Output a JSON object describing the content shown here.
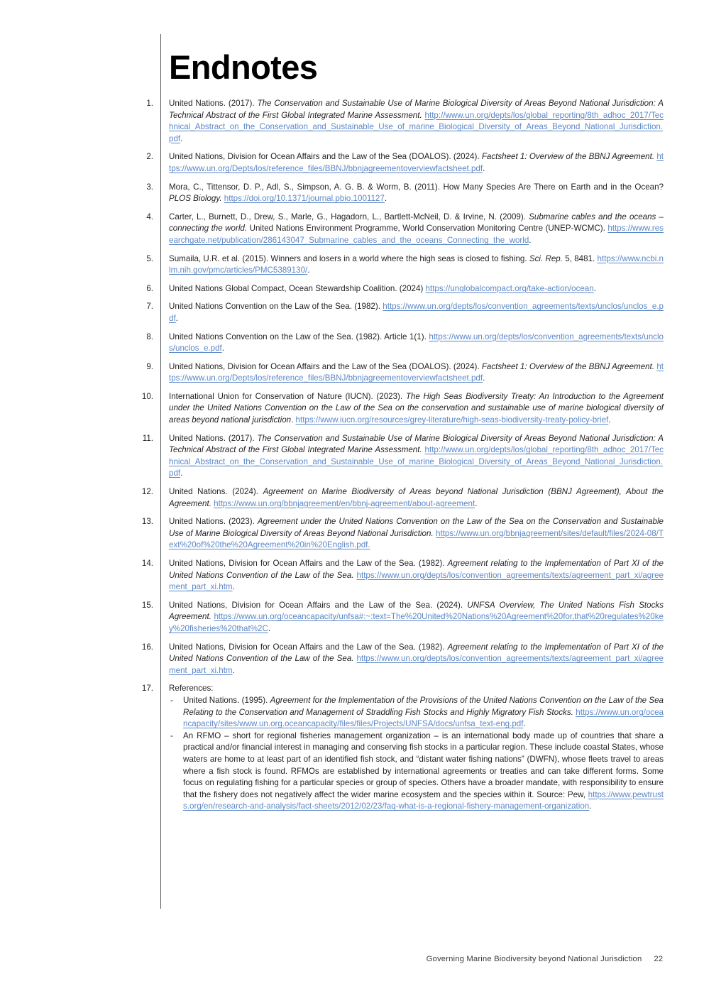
{
  "document": {
    "title": "Endnotes",
    "link_color": "#5b87c7",
    "text_color": "#231f20"
  },
  "footer": {
    "text": "Governing Marine Biodiversity beyond National Jurisdiction",
    "page_number": "22"
  },
  "endnotes": [
    {
      "number": "1.",
      "parts": [
        {
          "type": "text",
          "value": "United Nations. (2017). "
        },
        {
          "type": "italic",
          "value": "The Conservation and Sustainable Use of Marine Biological Diversity of Areas Beyond National Jurisdiction: A Technical Abstract of the First Global Integrated Marine Assessment."
        },
        {
          "type": "text",
          "value": " "
        },
        {
          "type": "link",
          "value": "http://www.un.org/depts/los/global_reporting/8th_adhoc_2017/Technical_Abstract_on_the_Conservation_and_Sustainable_Use_of_marine_Biological_Diversity_of_Areas_Beyond_National_Jurisdiction.pdf"
        },
        {
          "type": "text",
          "value": "."
        }
      ]
    },
    {
      "number": "2.",
      "parts": [
        {
          "type": "text",
          "value": "United Nations, Division for Ocean Affairs and the Law of the Sea (DOALOS). (2024). "
        },
        {
          "type": "italic",
          "value": "Factsheet 1: Overview of the BBNJ Agreement."
        },
        {
          "type": "text",
          "value": " "
        },
        {
          "type": "link",
          "value": "https://www.un.org/Depts/los/reference_files/BBNJ/bbnjagreementoverviewfactsheet.pdf"
        },
        {
          "type": "text",
          "value": "."
        }
      ]
    },
    {
      "number": "3.",
      "parts": [
        {
          "type": "text",
          "value": "Mora, C., Tittensor, D. P., Adl, S., Simpson, A. G. B. & Worm, B. (2011). How Many Species Are There on Earth and in the Ocean? "
        },
        {
          "type": "italic",
          "value": "PLOS Biology."
        },
        {
          "type": "text",
          "value": " "
        },
        {
          "type": "link",
          "value": "https://doi.org/10.1371/journal.pbio.1001127"
        },
        {
          "type": "text",
          "value": "."
        }
      ]
    },
    {
      "number": "4.",
      "parts": [
        {
          "type": "text",
          "value": "Carter, L., Burnett, D., Drew, S., Marle, G., Hagadorn, L., Bartlett-McNeil, D. & Irvine, N. (2009). "
        },
        {
          "type": "italic",
          "value": "Submarine cables and the oceans – connecting the world."
        },
        {
          "type": "text",
          "value": " United Nations Environment Programme, World Conservation Monitoring Centre (UNEP-WCMC). "
        },
        {
          "type": "link",
          "value": "https://www.researchgate.net/publication/286143047_Submarine_cables_and_the_oceans_Connecting_the_world"
        },
        {
          "type": "text",
          "value": "."
        }
      ]
    },
    {
      "number": "5.",
      "parts": [
        {
          "type": "text",
          "value": "Sumaila, U.R. et al. (2015). Winners and losers in a world where the high seas is closed to fishing. "
        },
        {
          "type": "italic",
          "value": "Sci. Rep."
        },
        {
          "type": "text",
          "value": " 5, 8481. "
        },
        {
          "type": "link",
          "value": "https://www.ncbi.nlm.nih.gov/pmc/articles/PMC5389130/"
        },
        {
          "type": "text",
          "value": "."
        }
      ]
    },
    {
      "number": "6.",
      "parts": [
        {
          "type": "text",
          "value": "United Nations Global Compact, Ocean Stewardship Coalition. (2024) "
        },
        {
          "type": "link",
          "value": "https://unglobalcompact.org/take-action/ocean"
        },
        {
          "type": "text",
          "value": "."
        }
      ]
    },
    {
      "number": "7.",
      "parts": [
        {
          "type": "text",
          "value": "United Nations Convention on the Law of the Sea. (1982). "
        },
        {
          "type": "link",
          "value": "https://www.un.org/depts/los/convention_agreements/texts/unclos/unclos_e.pdf"
        },
        {
          "type": "text",
          "value": "."
        }
      ]
    },
    {
      "number": "8.",
      "parts": [
        {
          "type": "text",
          "value": "United Nations Convention on the Law of the Sea. (1982). Article 1(1). "
        },
        {
          "type": "link",
          "value": "https://www.un.org/depts/los/convention_agreements/texts/unclos/unclos_e.pdf"
        },
        {
          "type": "text",
          "value": "."
        }
      ]
    },
    {
      "number": "9.",
      "parts": [
        {
          "type": "text",
          "value": "United Nations, Division for Ocean Affairs and the Law of the Sea (DOALOS). (2024). "
        },
        {
          "type": "italic",
          "value": "Factsheet 1: Overview of the BBNJ Agreement."
        },
        {
          "type": "text",
          "value": " "
        },
        {
          "type": "link",
          "value": "https://www.un.org/Depts/los/reference_files/BBNJ/bbnjagreementoverviewfactsheet.pdf"
        },
        {
          "type": "text",
          "value": "."
        }
      ]
    },
    {
      "number": "10.",
      "parts": [
        {
          "type": "text",
          "value": "International Union for Conservation of Nature (IUCN). (2023). "
        },
        {
          "type": "italic",
          "value": "The High Seas Biodiversity Treaty: An Introduction to the Agreement under the United Nations Convention on the Law of the Sea on the conservation and sustainable use of marine biological diversity of areas beyond national jurisdiction"
        },
        {
          "type": "text",
          "value": ". "
        },
        {
          "type": "link",
          "value": "https://www.iucn.org/resources/grey-literature/high-seas-biodiversity-treaty-policy-brief"
        },
        {
          "type": "text",
          "value": "."
        }
      ]
    },
    {
      "number": "11.",
      "parts": [
        {
          "type": "text",
          "value": "United Nations. (2017). "
        },
        {
          "type": "italic",
          "value": "The Conservation and Sustainable Use of Marine Biological Diversity of Areas Beyond National Jurisdiction: A Technical Abstract of the First Global Integrated Marine Assessment."
        },
        {
          "type": "text",
          "value": " "
        },
        {
          "type": "link",
          "value": "http://www.un.org/depts/los/global_reporting/8th_adhoc_2017/Technical_Abstract_on_the_Conservation_and_Sustainable_Use_of_marine_Biological_Diversity_of_Areas_Beyond_National_Jurisdiction.pdf"
        },
        {
          "type": "text",
          "value": "."
        }
      ]
    },
    {
      "number": "12.",
      "parts": [
        {
          "type": "text",
          "value": "United Nations. (2024). "
        },
        {
          "type": "italic",
          "value": "Agreement on Marine Biodiversity of Areas beyond National Jurisdiction (BBNJ Agreement), About the Agreement."
        },
        {
          "type": "text",
          "value": " "
        },
        {
          "type": "link",
          "value": "https://www.un.org/bbnjagreement/en/bbnj-agreement/about-agreement"
        },
        {
          "type": "text",
          "value": "."
        }
      ]
    },
    {
      "number": "13.",
      "parts": [
        {
          "type": "text",
          "value": "United Nations. (2023). "
        },
        {
          "type": "italic",
          "value": "Agreement under the United Nations Convention on the Law of the Sea on the Conservation and Sustainable Use of Marine Biological Diversity of Areas Beyond National Jurisdiction."
        },
        {
          "type": "text",
          "value": " "
        },
        {
          "type": "link",
          "value": "https://www.un.org/bbnjagreement/sites/default/files/2024-08/Text%20of%20the%20Agreement%20in%20English.pdf."
        }
      ]
    },
    {
      "number": "14.",
      "parts": [
        {
          "type": "text",
          "value": "United Nations, Division for Ocean Affairs and the Law of the Sea. (1982). "
        },
        {
          "type": "italic",
          "value": "Agreement relating to the Implementation of Part XI of the United Nations Convention of the Law of the Sea."
        },
        {
          "type": "text",
          "value": " "
        },
        {
          "type": "link",
          "value": "https://www.un.org/depts/los/convention_agreements/texts/agreement_part_xi/agreement_part_xi.htm"
        },
        {
          "type": "text",
          "value": "."
        }
      ]
    },
    {
      "number": "15.",
      "parts": [
        {
          "type": "text",
          "value": "United Nations, Division for Ocean Affairs and the Law of the Sea. (2024). "
        },
        {
          "type": "italic",
          "value": "UNFSA Overview, The United Nations Fish Stocks Agreement."
        },
        {
          "type": "text",
          "value": " "
        },
        {
          "type": "link",
          "value": "https://www.un.org/oceancapacity/unfsa#:~:text=The%20United%20Nations%20Agreement%20for,that%20regulates%20key%20fisheries%20that%2C"
        },
        {
          "type": "text",
          "value": "."
        }
      ]
    },
    {
      "number": "16.",
      "parts": [
        {
          "type": "text",
          "value": "United Nations, Division for Ocean Affairs and the Law of the Sea. (1982). "
        },
        {
          "type": "italic",
          "value": "Agreement relating to the Implementation of Part XI of the United Nations Convention of the Law of the Sea."
        },
        {
          "type": "text",
          "value": " "
        },
        {
          "type": "link",
          "value": "https://www.un.org/depts/los/convention_agreements/texts/agreement_part_xi/agreement_part_xi.htm"
        },
        {
          "type": "text",
          "value": "."
        }
      ]
    },
    {
      "number": "17.",
      "parts": [
        {
          "type": "text",
          "value": "References:"
        }
      ],
      "sublist": [
        {
          "bullet": "-",
          "parts": [
            {
              "type": "text",
              "value": "United Nations. (1995). "
            },
            {
              "type": "italic",
              "value": "Agreement for the Implementation of the Provisions of the United Nations Convention on the Law of the Sea Relating to the Conservation and Management of Straddling Fish Stocks and Highly Migratory Fish Stocks."
            },
            {
              "type": "text",
              "value": " "
            },
            {
              "type": "link",
              "value": "https://www.un.org/oceancapacity/sites/www.un.org.oceancapacity/files/files/Projects/UNFSA/docs/unfsa_text-eng.pdf"
            },
            {
              "type": "text",
              "value": "."
            }
          ]
        },
        {
          "bullet": "-",
          "parts": [
            {
              "type": "text",
              "value": "An RFMO – short for regional fisheries management organization – is an international body made up of countries that share a practical and/or financial interest in managing and conserving fish stocks in a particular region. These include coastal States, whose waters are home to at least part of an identified fish stock, and “distant water fishing nations” (DWFN), whose fleets travel to areas where a fish stock is found. RFMOs are established by international agreements or treaties and can take different forms. Some focus on regulating fishing for a particular species or group of species. Others have a broader mandate, with responsibility to ensure that the fishery does not negatively affect the wider marine ecosystem and the species within it. Source: Pew, "
            },
            {
              "type": "link",
              "value": "https://www.pewtrusts.org/en/research-and-analysis/fact-sheets/2012/02/23/faq-what-is-a-regional-fishery-management-organization"
            },
            {
              "type": "text",
              "value": "."
            }
          ]
        }
      ]
    }
  ]
}
